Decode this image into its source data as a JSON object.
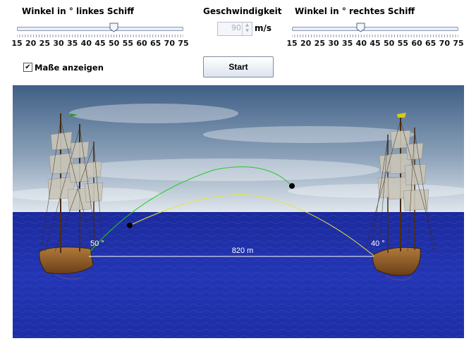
{
  "left_slider": {
    "title": "Winkel in ° linkes Schiff",
    "min": 15,
    "max": 75,
    "value": 50,
    "tick_labels": [
      "15",
      "20",
      "25",
      "30",
      "35",
      "40",
      "45",
      "50",
      "55",
      "60",
      "65",
      "70",
      "75"
    ]
  },
  "right_slider": {
    "title": "Winkel in ° rechtes Schiff",
    "min": 15,
    "max": 75,
    "value": 40,
    "tick_labels": [
      "15",
      "20",
      "25",
      "30",
      "35",
      "40",
      "45",
      "50",
      "55",
      "60",
      "65",
      "70",
      "75"
    ]
  },
  "speed": {
    "title": "Geschwindigkeit",
    "value": "90",
    "unit": "m/s"
  },
  "show_measures": {
    "label": "Maße anzeigen",
    "checked": true,
    "check_glyph": "✔"
  },
  "start_button": {
    "label": "Start"
  },
  "scene": {
    "left_angle_label": "50 °",
    "right_angle_label": "40 °",
    "distance_label": "820 m",
    "left_trajectory_color": "#22cc22",
    "right_trajectory_color": "#e6e633",
    "sky_top_color": "#3f5f86",
    "sea_color": "#1e2fa8",
    "left_flag_color": "#2a9a2a",
    "right_flag_color": "#d8c81a"
  }
}
